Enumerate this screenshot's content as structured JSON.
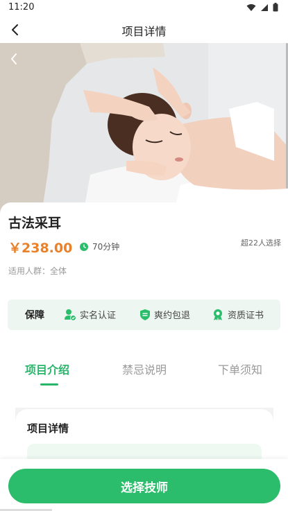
{
  "status_bar": {
    "time": "11:20"
  },
  "nav": {
    "title": "项目详情"
  },
  "service": {
    "name": "古法采耳",
    "price": "￥238.00",
    "duration": "70分钟",
    "sales": "超22人选择",
    "audience": "适用人群：全体"
  },
  "guarantee": {
    "title": "保障",
    "items": [
      {
        "label": "实名认证",
        "icon": "verified-user-icon"
      },
      {
        "label": "爽约包退",
        "icon": "refund-shield-icon"
      },
      {
        "label": "资质证书",
        "icon": "certificate-icon"
      }
    ]
  },
  "tabs": [
    {
      "label": "项目介绍",
      "active": true
    },
    {
      "label": "禁忌说明",
      "active": false
    },
    {
      "label": "下单须知",
      "active": false
    }
  ],
  "details": {
    "title": "项目详情"
  },
  "cta": {
    "label": "选择技师"
  },
  "colors": {
    "accent": "#2cbd6c",
    "price": "#e9812a",
    "guarantee_bg": "#eef6f2"
  }
}
